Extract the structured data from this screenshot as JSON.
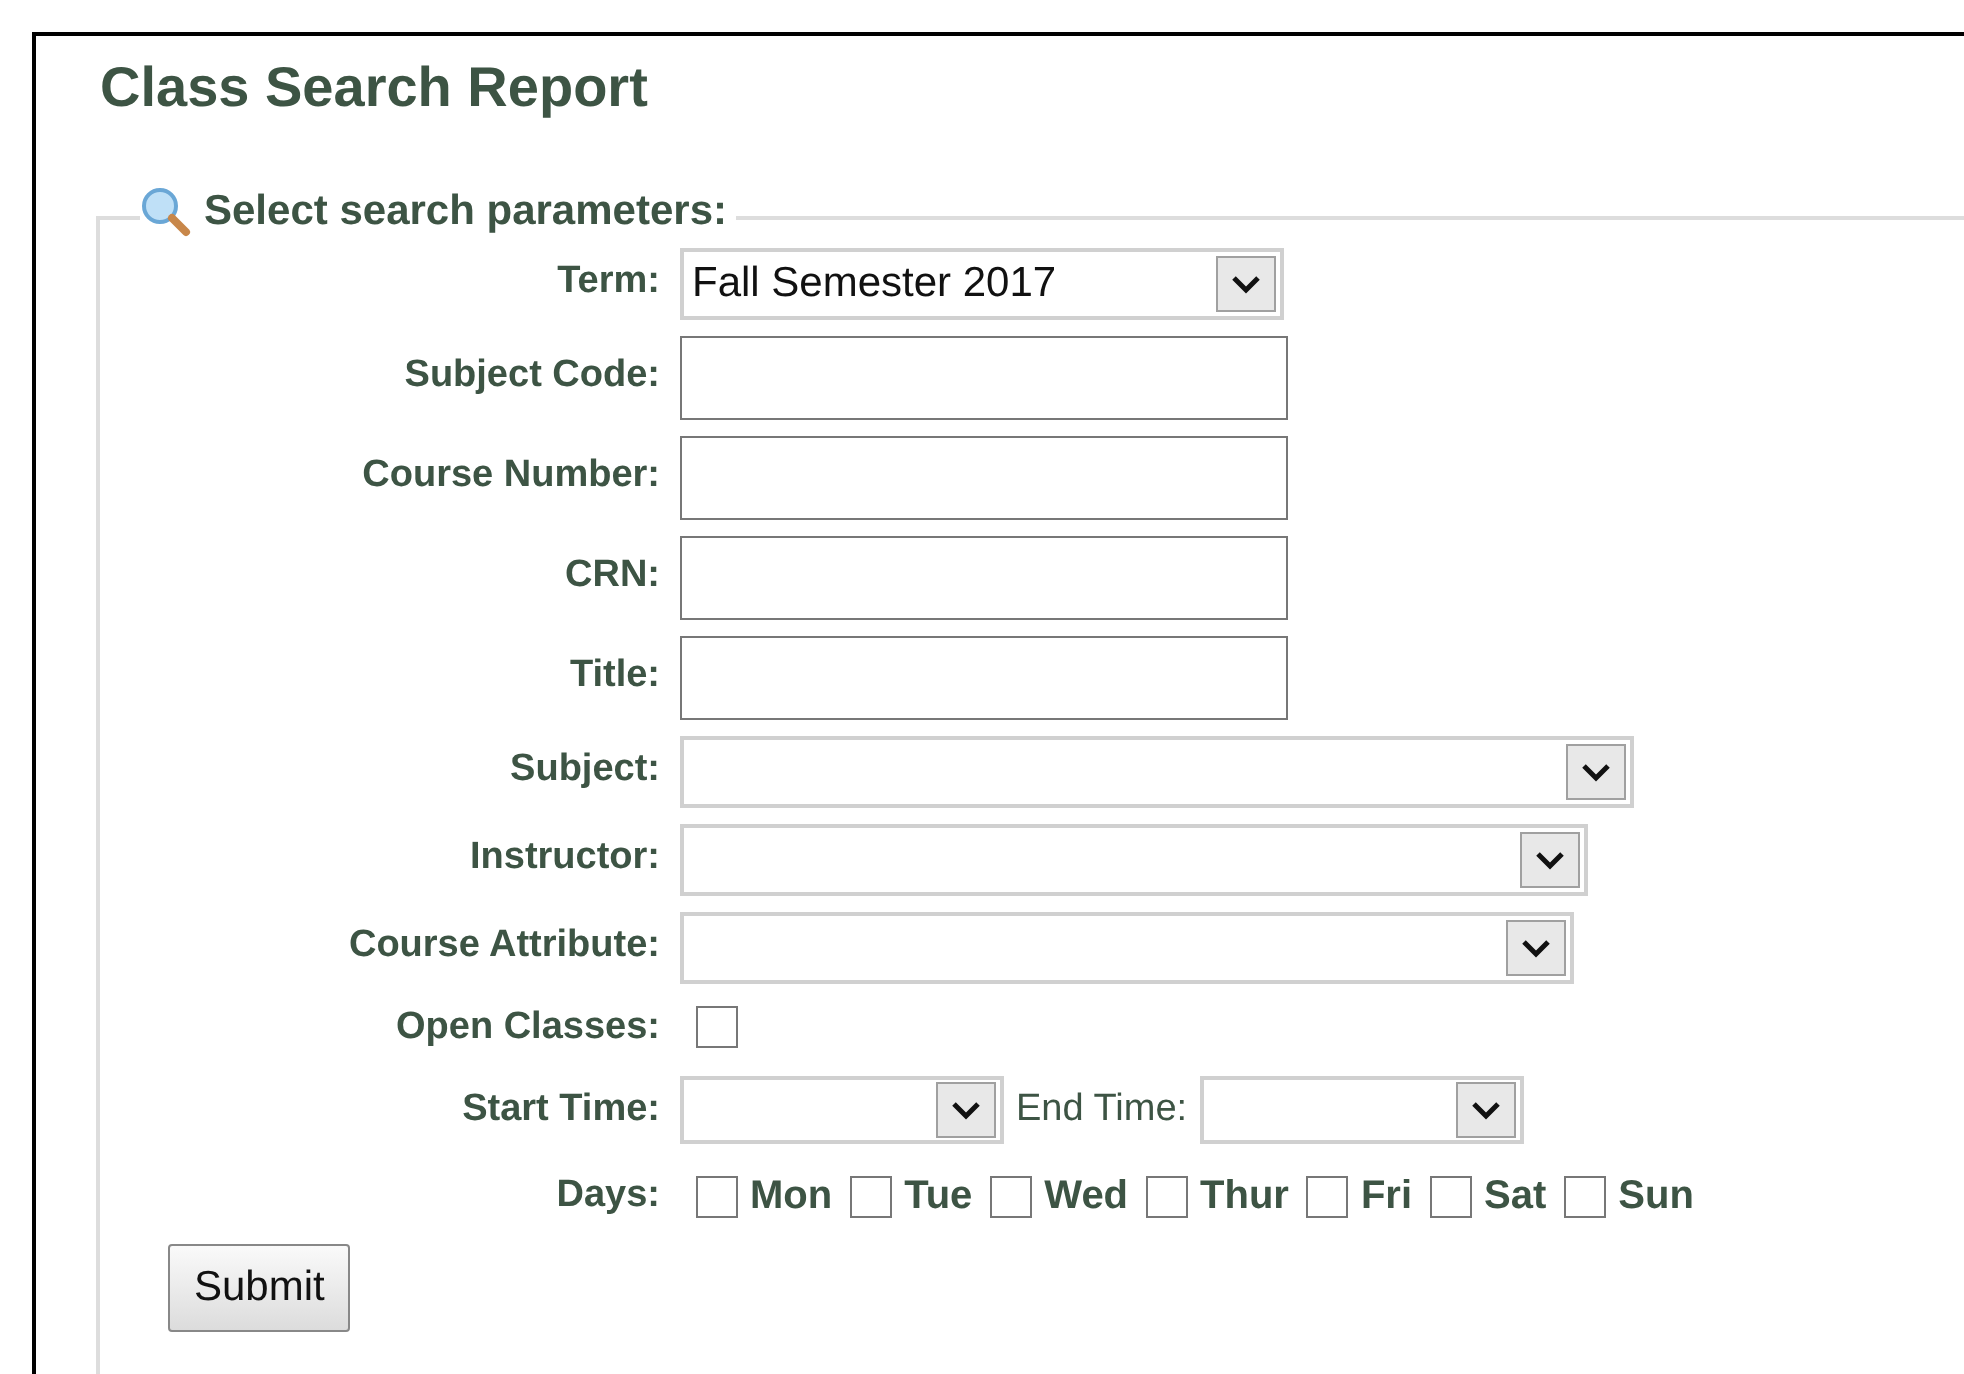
{
  "title": "Class Search Report",
  "legend": "Select search parameters:",
  "fields": [
    {
      "kind": "select",
      "label": "Term:",
      "value": "Fall Semester 2017"
    },
    {
      "kind": "text",
      "label": "Subject Code:"
    },
    {
      "kind": "text",
      "label": "Course Number:"
    },
    {
      "kind": "text",
      "label": "CRN:"
    },
    {
      "kind": "text",
      "label": "Title:"
    },
    {
      "kind": "select",
      "label": "Subject:"
    },
    {
      "kind": "select",
      "label": "Instructor:"
    },
    {
      "kind": "select",
      "label": "Course Attribute:"
    },
    {
      "kind": "checkbox",
      "label": "Open Classes:",
      "checked": false
    },
    {
      "kind": "times",
      "label": "Start Time:",
      "second_label": "End Time:"
    },
    {
      "kind": "days",
      "label": "Days:",
      "days": [
        {
          "label": "Mon",
          "checked": false
        },
        {
          "label": "Tue",
          "checked": false
        },
        {
          "label": "Wed",
          "checked": false
        },
        {
          "label": "Thur",
          "checked": false
        },
        {
          "label": "Fri",
          "checked": false
        },
        {
          "label": "Sat",
          "checked": false
        },
        {
          "label": "Sun",
          "checked": false
        }
      ]
    }
  ],
  "submit": "Submit"
}
